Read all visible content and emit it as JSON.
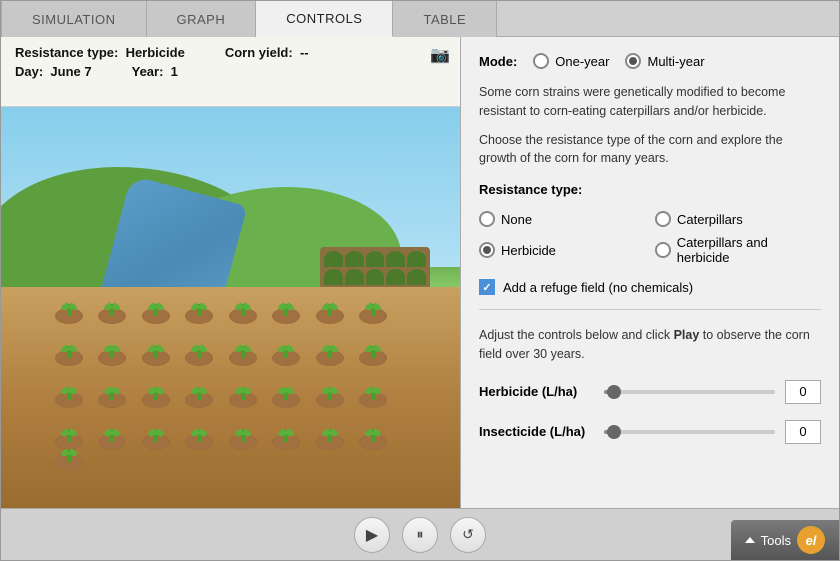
{
  "tabs": [
    {
      "id": "simulation",
      "label": "SIMULATION",
      "active": false
    },
    {
      "id": "graph",
      "label": "GRAPH",
      "active": false
    },
    {
      "id": "controls",
      "label": "CONTROLS",
      "active": true
    },
    {
      "id": "table",
      "label": "TABLE",
      "active": false
    }
  ],
  "sim_info": {
    "resistance_label": "Resistance type:",
    "resistance_value": "Herbicide",
    "corn_yield_label": "Corn yield:",
    "corn_yield_value": "--",
    "day_label": "Day:",
    "day_value": "June 7",
    "year_label": "Year:",
    "year_value": "1"
  },
  "controls": {
    "mode_label": "Mode:",
    "mode_one_year": "One-year",
    "mode_multi_year": "Multi-year",
    "mode_selected": "multi-year",
    "description1": "Some corn strains were genetically modified to become resistant to corn-eating caterpillars and/or herbicide.",
    "description2": "Choose the resistance type of the corn and explore the growth of the corn for many years.",
    "resistance_type_label": "Resistance type:",
    "resistance_options": [
      {
        "id": "none",
        "label": "None",
        "selected": false
      },
      {
        "id": "caterpillars",
        "label": "Caterpillars",
        "selected": false
      },
      {
        "id": "herbicide",
        "label": "Herbicide",
        "selected": true
      },
      {
        "id": "caterpillars_herbicide",
        "label": "Caterpillars and herbicide",
        "selected": false
      }
    ],
    "refuge_checkbox_label": "Add a refuge field (no chemicals)",
    "refuge_checked": true,
    "adjust_text": "Adjust the controls below and click",
    "adjust_bold": "Play",
    "adjust_text2": "to observe the corn field over 30 years.",
    "herbicide_label": "Herbicide (L/ha)",
    "herbicide_value": "0",
    "insecticide_label": "Insecticide (L/ha)",
    "insecticide_value": "0"
  },
  "bottom_bar": {
    "tools_label": "Tools"
  }
}
